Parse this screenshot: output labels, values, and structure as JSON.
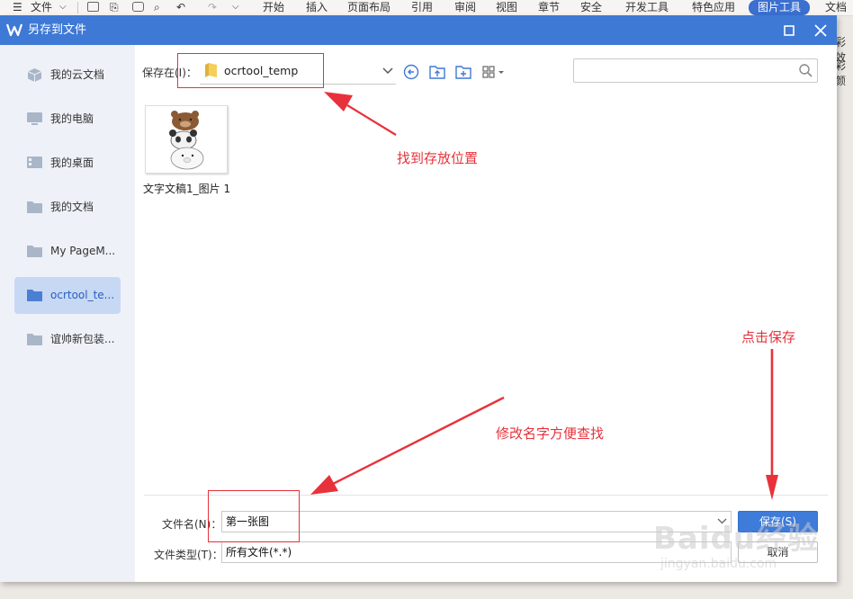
{
  "toolbar": {
    "file_menu": "文件",
    "tabs": [
      "开始",
      "插入",
      "页面布局",
      "引用",
      "审阅",
      "视图",
      "章节",
      "安全",
      "开发工具",
      "特色应用",
      "图片工具",
      "文档"
    ]
  },
  "background": {
    "right_text_1": "彩效",
    "right_text_2": "彩颜"
  },
  "dialog": {
    "title": "另存到文件",
    "sidebar": [
      {
        "label": "我的云文档",
        "icon": "cloud-cube-icon"
      },
      {
        "label": "我的电脑",
        "icon": "monitor-icon"
      },
      {
        "label": "我的桌面",
        "icon": "desktop-icon"
      },
      {
        "label": "我的文档",
        "icon": "folder-icon"
      },
      {
        "label": "My PageM...",
        "icon": "folder-icon"
      },
      {
        "label": "ocrtool_te...",
        "icon": "folder-icon",
        "selected": true
      },
      {
        "label": "谊帅新包装...",
        "icon": "folder-icon"
      }
    ],
    "location_label": "保存在(I)：",
    "location_value": "ocrtool_temp",
    "search_placeholder": "",
    "files": [
      {
        "name": "文字文稿1_图片 1"
      }
    ],
    "filename_label": "文件名(N)：",
    "filename_value": "第一张图",
    "filetype_label": "文件类型(T)：",
    "filetype_value": "所有文件(*.*)",
    "save_label": "保存(S)",
    "cancel_label": "取消"
  },
  "annotations": {
    "find_location": "找到存放位置",
    "rename": "修改名字方便查找",
    "click_save": "点击保存"
  },
  "watermark": {
    "brand": "Baidu经验",
    "url": "jingyan.baidu.com"
  },
  "colors": {
    "titlebar": "#3f79d6",
    "accent": "#3f7bd9",
    "annotation": "#e5323b",
    "sidebar_selected": "#c6d8f3"
  }
}
